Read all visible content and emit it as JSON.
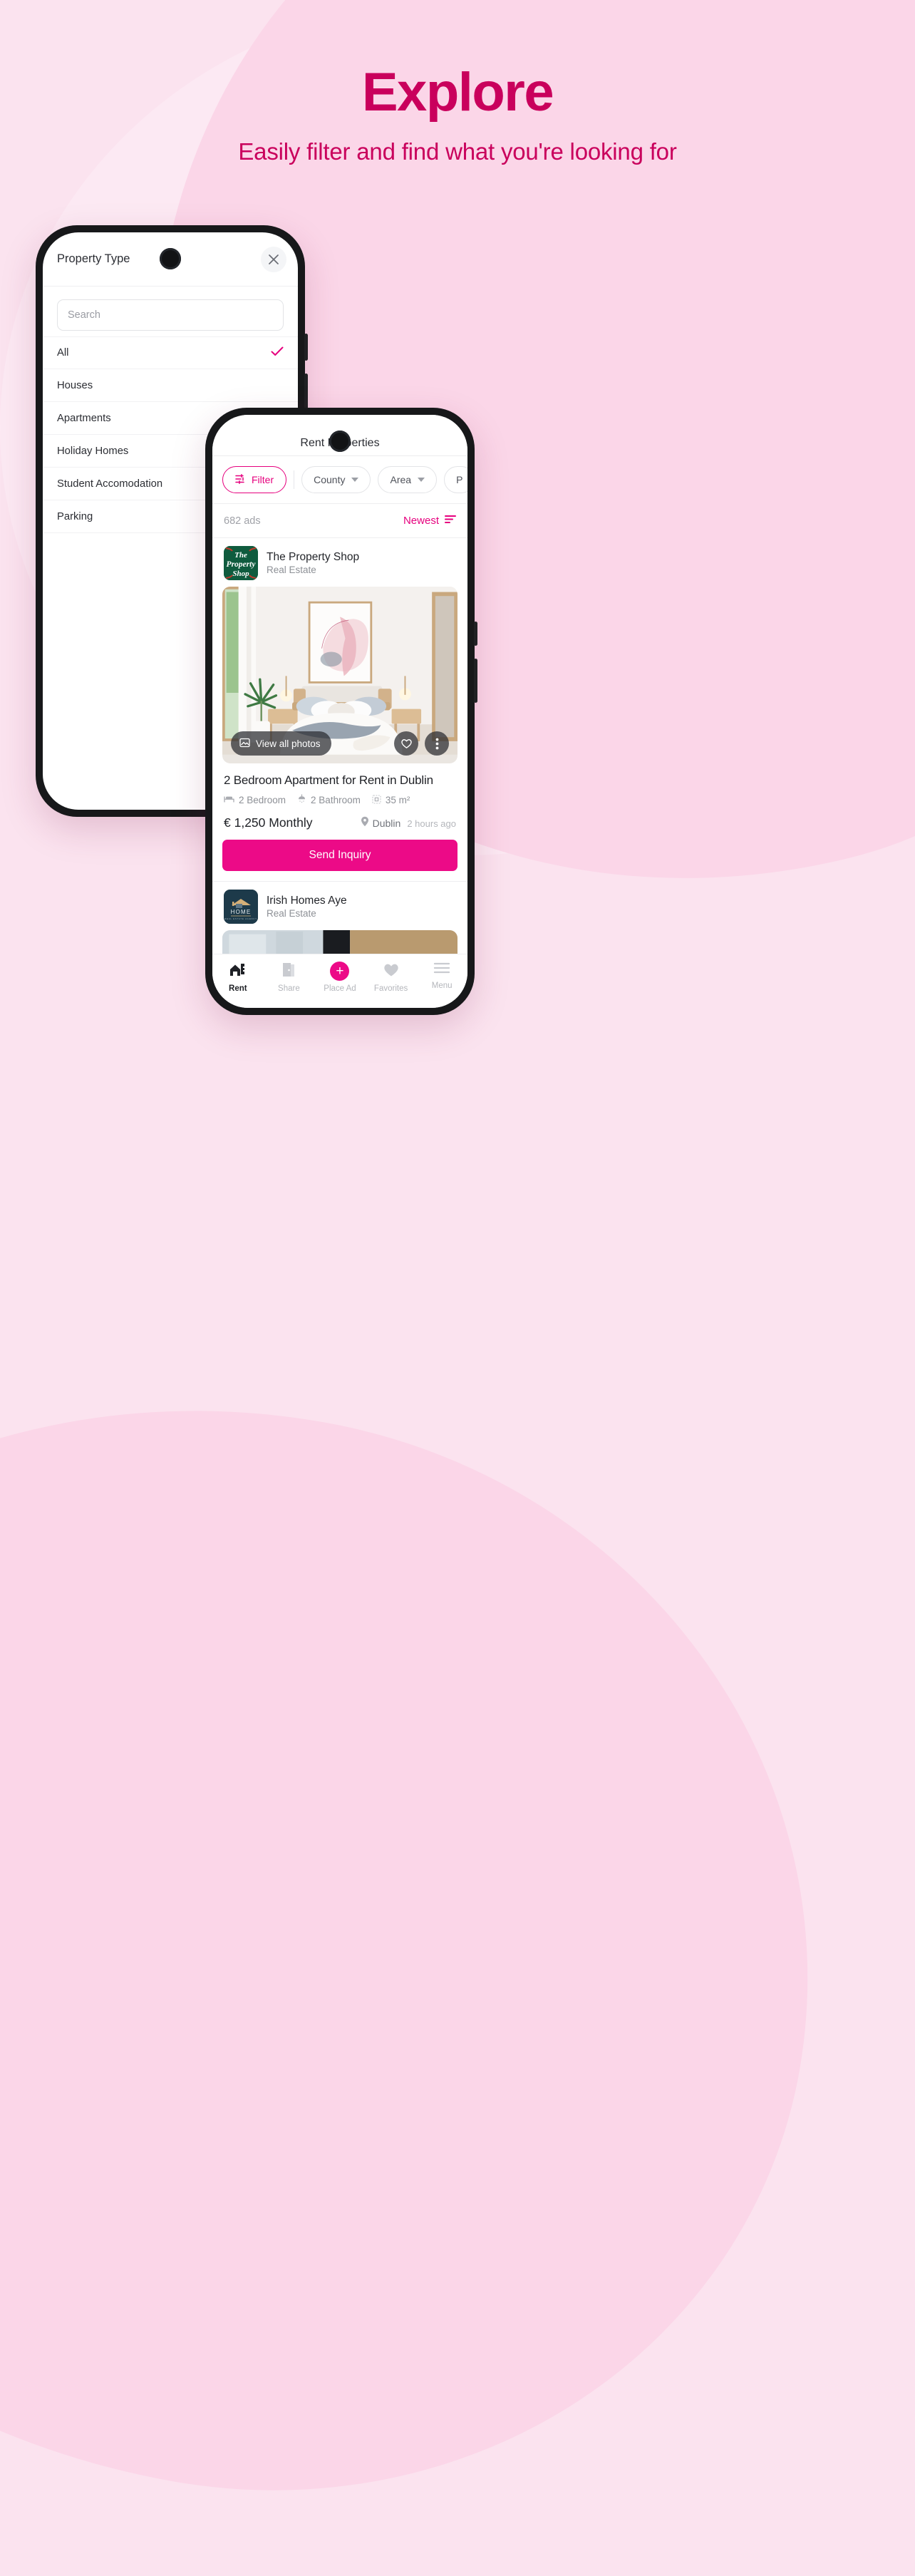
{
  "header": {
    "title": "Explore",
    "subtitle": "Easily filter and find what you're looking for",
    "title_color": "#c9005c"
  },
  "colors": {
    "accent_pink": "#e6007e",
    "button_pink": "#ec0a87",
    "bg_light": "#fbe3ef",
    "bg_deep": "#fbd6e8"
  },
  "phone_left": {
    "sheet": {
      "title": "Property Type",
      "close_icon": "close-icon",
      "search_placeholder": "Search",
      "items": [
        {
          "label": "All",
          "selected": true
        },
        {
          "label": "Houses",
          "selected": false
        },
        {
          "label": "Apartments",
          "selected": false
        },
        {
          "label": "Holiday Homes",
          "selected": false
        },
        {
          "label": "Student Accomodation",
          "selected": false
        },
        {
          "label": "Parking",
          "selected": false
        }
      ]
    }
  },
  "phone_right": {
    "app_bar": {
      "title": "Rent Properties"
    },
    "chips": [
      {
        "label": "Filter",
        "icon": "filter-sliders-icon",
        "primary": true,
        "caret": false
      },
      {
        "label": "County",
        "icon": "",
        "primary": false,
        "caret": true
      },
      {
        "label": "Area",
        "icon": "",
        "primary": false,
        "caret": true
      },
      {
        "label": "P",
        "icon": "",
        "primary": false,
        "caret": false
      }
    ],
    "results": {
      "count_label": "682 ads",
      "sort_label": "Newest",
      "sort_icon": "sort-descending-icon"
    },
    "listings": [
      {
        "agency": {
          "name": "The Property Shop",
          "type": "Real Estate",
          "logo_text": "The Property Shop",
          "logo_color": "#0f5b3e"
        },
        "photo": {
          "view_all_label": "View all photos",
          "photo_icon": "image-icon",
          "favorite_icon": "heart-outline-icon",
          "more_icon": "more-vertical-icon"
        },
        "title": "2 Bedroom Apartment for Rent in Dublin",
        "features": [
          {
            "icon": "bed-icon",
            "label": "2 Bedroom"
          },
          {
            "icon": "shower-icon",
            "label": "2 Bathroom"
          },
          {
            "icon": "area-icon",
            "label": "35 m²"
          }
        ],
        "price": "€ 1,250 Monthly",
        "location": "Dublin",
        "location_icon": "map-pin-icon",
        "posted": "2 hours ago",
        "cta": "Send Inquiry"
      },
      {
        "agency": {
          "name": "Irish Homes Aye",
          "type": "Real Estate",
          "logo_text": "HOME",
          "logo_color": "#1d3a4a"
        }
      }
    ],
    "bottom_nav": [
      {
        "label": "Rent",
        "icon": "house-key-icon",
        "active": true
      },
      {
        "label": "Share",
        "icon": "door-icon",
        "active": false
      },
      {
        "label": "Place Ad",
        "icon": "plus-circle-icon",
        "active": false
      },
      {
        "label": "Favorites",
        "icon": "heart-filled-icon",
        "active": false
      },
      {
        "label": "Menu",
        "icon": "hamburger-icon",
        "active": false
      }
    ]
  }
}
